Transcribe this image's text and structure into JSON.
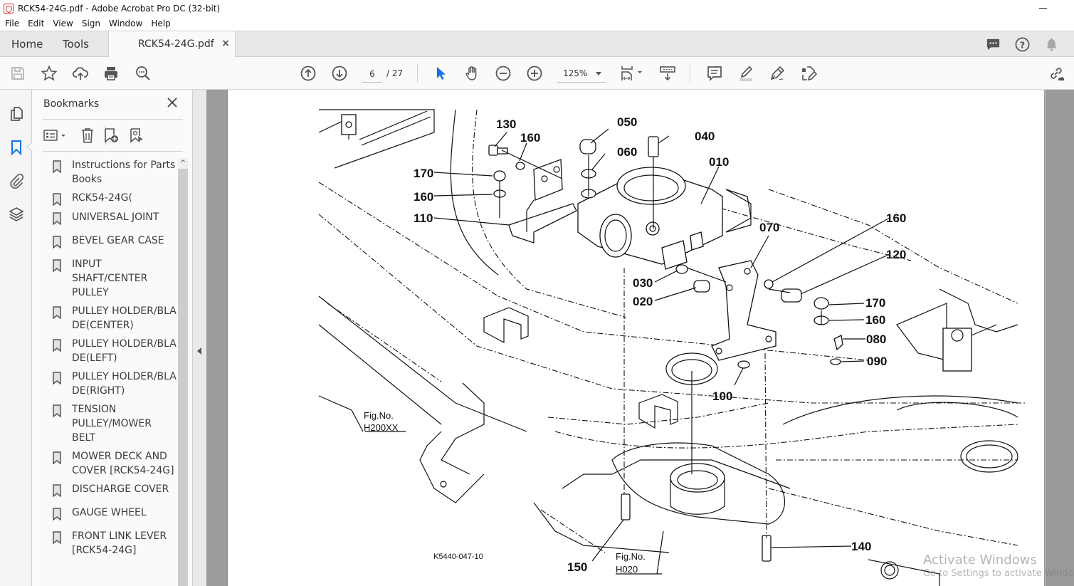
{
  "window": {
    "title": "RCK54-24G.pdf - Adobe Acrobat Pro DC (32-bit)"
  },
  "menu": [
    "File",
    "Edit",
    "View",
    "Sign",
    "Window",
    "Help"
  ],
  "tabs": {
    "home": "Home",
    "tools": "Tools",
    "document": "RCK54-24G.pdf",
    "close_symbol": "×"
  },
  "toolbar": {
    "page_current": "6",
    "page_total": "/ 27",
    "zoom_level": "125%",
    "accent_color": "#1473e6"
  },
  "bookmarks": {
    "header": "Bookmarks",
    "items": [
      {
        "label": "Instructions for Parts Books"
      },
      {
        "label": "RCK54-24G("
      },
      {
        "label": "UNIVERSAL JOINT"
      },
      {
        "label": "BEVEL GEAR CASE"
      },
      {
        "label": "INPUT SHAFT/CENTER PULLEY"
      },
      {
        "label": "PULLEY HOLDER/BLADE(CENTER)"
      },
      {
        "label": "PULLEY HOLDER/BLADE(LEFT)"
      },
      {
        "label": "PULLEY HOLDER/BLADE(RIGHT)"
      },
      {
        "label": "TENSION PULLEY/MOWER BELT"
      },
      {
        "label": "MOWER DECK AND COVER [RCK54-24G]"
      },
      {
        "label": "DISCHARGE COVER"
      },
      {
        "label": "GAUGE WHEEL"
      },
      {
        "label": "FRONT LINK LEVER [RCK54-24G]"
      }
    ]
  },
  "diagram": {
    "callouts": [
      "130",
      "160",
      "050",
      "040",
      "060",
      "010",
      "170",
      "160",
      "110",
      "070",
      "160",
      "120",
      "030",
      "020",
      "170",
      "160",
      "080",
      "090",
      "100",
      "140",
      "150"
    ],
    "fig_ref_left": {
      "line1": "Fig.No.",
      "line2": "H200XX"
    },
    "fig_ref_bottom": {
      "line1": "Fig.No.",
      "line2": "H020"
    },
    "drawing_code": "K5440-047-10"
  },
  "watermark": {
    "line1": "Activate Windows",
    "line2": "Go to Settings to activate Windows."
  }
}
